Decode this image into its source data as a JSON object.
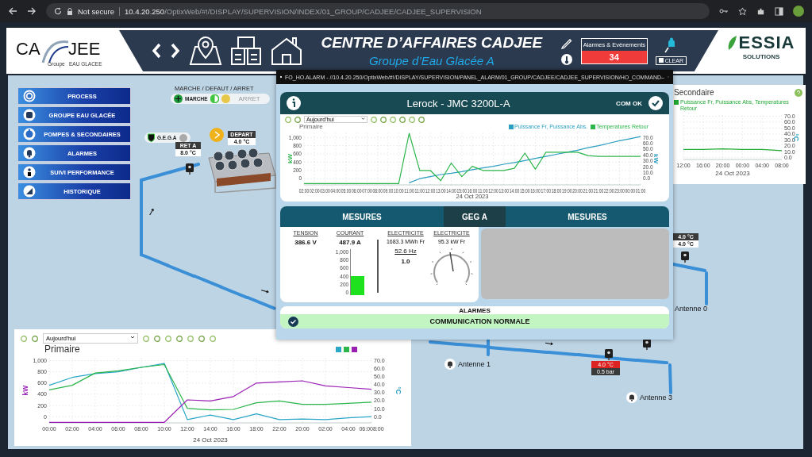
{
  "browser": {
    "security": "Not secure",
    "host": "10.4.20.250",
    "path": "/OptixWeb/#!/DISPLAY/SUPERVISION/INDEX/01_GROUP/CADJEE/CADJEE_SUPERVISION"
  },
  "header": {
    "logo": {
      "left": "CA",
      "right": "JEE",
      "sub_1": "Groupe",
      "sub_2": "EAU GLACEE"
    },
    "title": "CENTRE D’AFFAIRES CADJEE",
    "subtitle": "Groupe d’Eau Glacée A",
    "alarms": {
      "label": "Alarmes & Evènements",
      "count": "34"
    },
    "clear": "CLEAR",
    "brand": {
      "name": "ESSIA",
      "sub": "SOLUTIONS"
    }
  },
  "menu": [
    {
      "label": "PROCESS",
      "kind": "network"
    },
    {
      "label": "GROUPE EAU GLACÉE",
      "kind": "machine"
    },
    {
      "label": "POMPES & SECONDAIRES",
      "kind": "pump"
    },
    {
      "label": "ALARMES",
      "kind": "bell"
    },
    {
      "label": "SUIVI PERFORMANCE",
      "kind": "person"
    },
    {
      "label": "HISTORIQUE",
      "kind": "chart"
    }
  ],
  "status_legend": {
    "title": "MARCHE / DEFAUT / ARRET",
    "run": "MARCHE",
    "stop": "ARRET"
  },
  "diagram": {
    "unit": "G.E.G.A",
    "return": {
      "label": "RET A",
      "value": "8.0 °C"
    },
    "supply": {
      "label": "DEPART",
      "value": "4.0 °C"
    },
    "sensor_readings": [
      "4.0 °C",
      "4.0 °C"
    ],
    "alarm_reading": {
      "temperature": "4.0 °C",
      "pressure": "0.5 bar"
    },
    "antennas": [
      "Antenne 0",
      "Antenne 1",
      "Antenne 3"
    ]
  },
  "secondary_chart": {
    "title": "Secondaire",
    "chart_data": {
      "type": "line",
      "grid": true,
      "xlabel": "24 Oct 2023",
      "ylabel": "°C",
      "categories": [
        "12:00",
        "16:00",
        "20:00",
        "00:00",
        "04:00",
        "08:00"
      ],
      "ylim": [
        -3,
        72
      ],
      "yticks": [
        {
          "value": 0,
          "label": "0.0"
        },
        {
          "value": 10,
          "label": "10.0"
        },
        {
          "value": 20,
          "label": "20.0"
        },
        {
          "value": 30,
          "label": "30.0"
        },
        {
          "value": 40,
          "label": "40.0"
        },
        {
          "value": 50,
          "label": "50.0"
        },
        {
          "value": 60,
          "label": "60.0"
        },
        {
          "value": 70,
          "label": "70.0"
        }
      ],
      "series": [
        {
          "name": "Puissance Fr, Puissance Abs, Temperatures Retour",
          "color": "#22aa33",
          "values": [
            14,
            14,
            15,
            14,
            14,
            12
          ]
        }
      ]
    }
  },
  "primary_chart": {
    "range": "Aujourd'hui",
    "title": "Primaire",
    "right_axis": {
      "label": "°C",
      "ticks": [
        "70.0",
        "60.0",
        "50.0",
        "40.0",
        "30.0",
        "20.0",
        "10.0",
        "0.0"
      ]
    },
    "chart_data": {
      "type": "line",
      "grid": true,
      "xlabel": "24 Oct 2023",
      "ylabel": "kW",
      "categories": [
        "00:00",
        "02:00",
        "04:00",
        "06:00",
        "08:00",
        "10:00",
        "12:00",
        "14:00",
        "16:00",
        "18:00",
        "22:00",
        "20:00",
        "02:00",
        "04:00",
        "06:008:00"
      ],
      "ylim": [
        -110,
        1050
      ],
      "yticks": [
        0,
        200,
        400,
        600,
        800,
        {
          "value": 1000,
          "label": "1,000"
        }
      ],
      "series": [
        {
          "color": "#2aa6c9",
          "values": [
            560,
            700,
            770,
            800,
            880,
            950,
            -50,
            30,
            -50,
            50,
            -50,
            -40,
            -50,
            -20,
            0
          ]
        },
        {
          "color": "#2bb54a",
          "values": [
            480,
            560,
            780,
            820,
            880,
            930,
            150,
            120,
            130,
            250,
            280,
            220,
            220,
            240,
            260
          ]
        },
        {
          "color": "#9a1fb5",
          "values": [
            -100,
            -100,
            -100,
            -100,
            -100,
            -100,
            300,
            280,
            360,
            600,
            620,
            640,
            550,
            520,
            490
          ]
        }
      ]
    }
  },
  "popup": {
    "window_title": "FO_HO.ALARM - //10.4.20.250/OptixWeb/#!/DISPLAY/SUPERVISION/PANEL_ALARM/01_GROUP/CADJEE/CADJEE_SUPERVISION/HO_COMMAND–",
    "device": "Lerock - JMC 3200L-A",
    "com_status": "COM OK",
    "chart": {
      "range": "Aujourd'hui",
      "title": "Primaire",
      "right_axis": {
        "label": "kW",
        "ticks": [
          "70.0",
          "60.0",
          "50.0",
          "40.0",
          "30.0",
          "20.0",
          "10.0",
          "0.0"
        ]
      },
      "chart_data": {
        "type": "line",
        "grid": true,
        "xlabel": "24 Oct 2023",
        "ylabel": "kW",
        "categories": [
          "02:00",
          "02:00",
          "03:00",
          "04:00",
          "05:00",
          "06:00",
          "07:00",
          "08:00",
          "09:00",
          "10:00",
          "11:00",
          "11:00",
          "12:00",
          "13:00",
          "14:00",
          "15:00",
          "16:00",
          "11:00",
          "12:00",
          "13:00",
          "14:00",
          "15:00",
          "16:00",
          "17:00",
          "18:00",
          "19:00",
          "20:00",
          "21:00",
          "21:00",
          "22:00",
          "23:00",
          "00:00",
          "01:00"
        ],
        "ylim": [
          -150,
          1120
        ],
        "yticks": [
          0,
          200,
          400,
          600,
          800,
          {
            "value": 1000,
            "label": "1,000"
          }
        ],
        "series": [
          {
            "name": "Puissance Fr, Puissance Abs.",
            "color": "#2a9fc0",
            "values": [
              null,
              null,
              null,
              null,
              null,
              null,
              null,
              null,
              null,
              null,
              -100,
              0,
              50,
              100,
              130,
              170,
              220,
              260,
              300,
              350,
              390,
              440,
              490,
              540,
              590,
              640,
              690,
              750,
              800,
              860,
              920,
              970,
              1020
            ]
          },
          {
            "name": "Temperatures Retour",
            "color": "#2bb54a",
            "values": [
              -120,
              -120,
              -120,
              -120,
              -120,
              -120,
              -120,
              -120,
              -120,
              -120,
              1100,
              200,
              200,
              -50,
              380,
              50,
              300,
              200,
              200,
              200,
              250,
              620,
              230,
              640,
              640,
              640,
              640,
              560,
              540,
              540,
              540,
              540,
              540
            ]
          }
        ]
      }
    },
    "tabs": [
      {
        "label": "MESURES",
        "selected": false
      },
      {
        "label": "GEG A",
        "selected": true
      },
      {
        "label": "MESURES",
        "selected": false
      }
    ],
    "measures": {
      "voltage": {
        "label": "TENSION",
        "value": "386.6 V"
      },
      "current": {
        "label": "COURANT",
        "value": "487.9 A",
        "level": 0.41,
        "ticks": [
          "1,000",
          "800",
          "600",
          "400",
          "200",
          "0"
        ]
      },
      "energy": {
        "label": "ELECTRICITE",
        "value": "1683.3 MWh Fr",
        "frequency": "52.6 Hz",
        "factor": "1.0"
      },
      "power": {
        "label": "ELECTRICITE",
        "value": "95.3 kW Fr"
      }
    },
    "alarms": {
      "title": "ALARMES",
      "message": "COMMUNICATION NORMALE"
    }
  }
}
